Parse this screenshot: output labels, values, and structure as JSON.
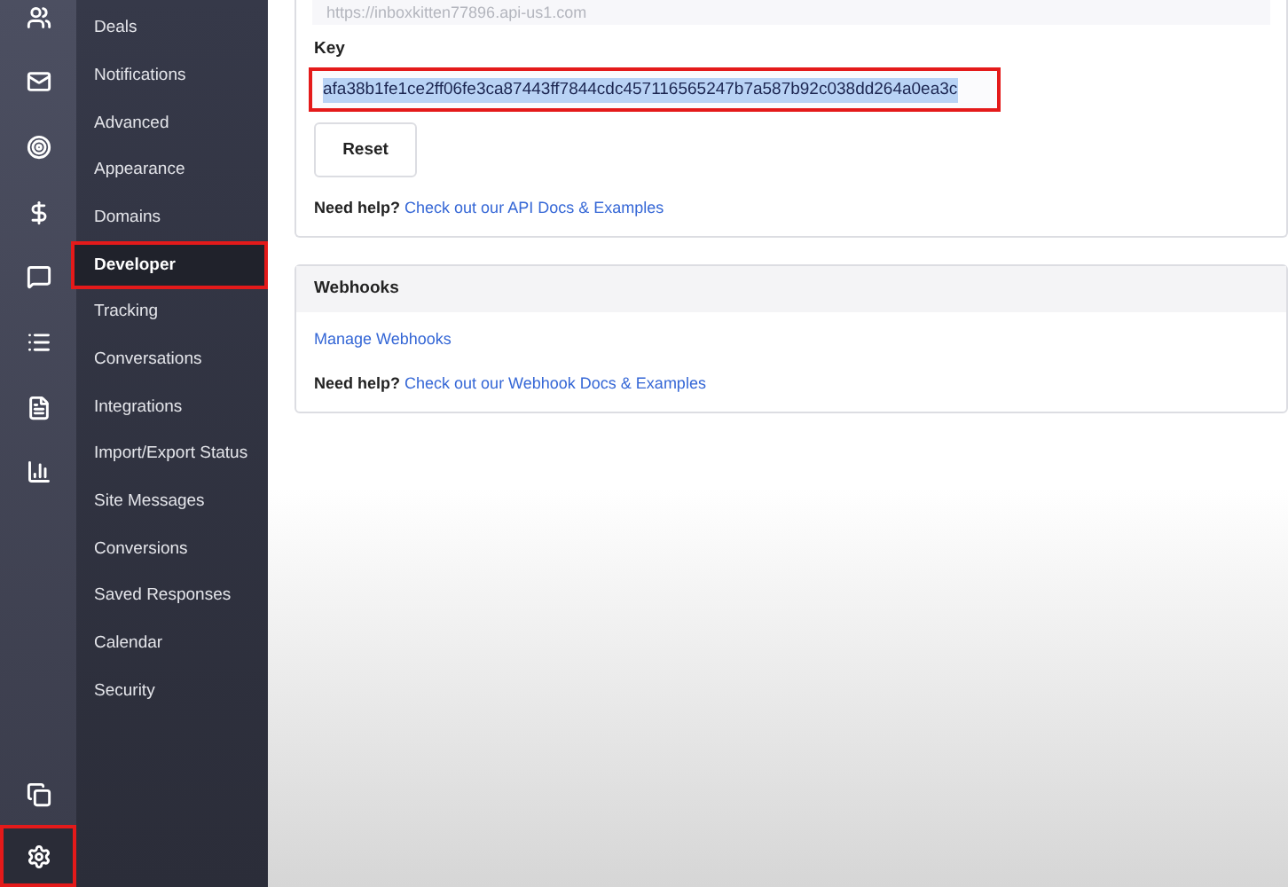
{
  "icon_rail": {
    "items": [
      {
        "kind": "contacts"
      },
      {
        "kind": "mail"
      },
      {
        "kind": "target"
      },
      {
        "kind": "dollar"
      },
      {
        "kind": "chat"
      },
      {
        "kind": "list"
      },
      {
        "kind": "form"
      },
      {
        "kind": "chart"
      }
    ],
    "bottom": [
      {
        "kind": "windows",
        "highlighted": false
      },
      {
        "kind": "settings",
        "highlighted": true
      }
    ]
  },
  "sidebar": {
    "items": [
      {
        "label": "Deals",
        "selected": false,
        "highlighted": false
      },
      {
        "label": "Notifications",
        "selected": false,
        "highlighted": false
      },
      {
        "label": "Advanced",
        "selected": false,
        "highlighted": false
      },
      {
        "label": "Appearance",
        "selected": false,
        "highlighted": false
      },
      {
        "label": "Domains",
        "selected": false,
        "highlighted": false
      },
      {
        "label": "Developer",
        "selected": true,
        "highlighted": true
      },
      {
        "label": "Tracking",
        "selected": false,
        "highlighted": false
      },
      {
        "label": "Conversations",
        "selected": false,
        "highlighted": false
      },
      {
        "label": "Integrations",
        "selected": false,
        "highlighted": false
      },
      {
        "label": "Import/Export Status",
        "selected": false,
        "highlighted": false
      },
      {
        "label": "Site Messages",
        "selected": false,
        "highlighted": false
      },
      {
        "label": "Conversions",
        "selected": false,
        "highlighted": false
      },
      {
        "label": "Saved Responses",
        "selected": false,
        "highlighted": false
      },
      {
        "label": "Calendar",
        "selected": false,
        "highlighted": false
      },
      {
        "label": "Security",
        "selected": false,
        "highlighted": false
      }
    ]
  },
  "api_card": {
    "url_value": "https://inboxkitten77896.api-us1.com",
    "key_label": "Key",
    "key_value": "afa38b1fe1ce2ff06fe3ca87443ff7844cdc457116565247b7a587b92c038dd264a0ea3c",
    "key_highlighted": true,
    "key_selected": true,
    "reset_button": "Reset",
    "help_label": "Need help?",
    "help_link": "Check out our API Docs & Examples"
  },
  "webhooks_card": {
    "title": "Webhooks",
    "manage_link": "Manage Webhooks",
    "help_label": "Need help?",
    "help_link": "Check out our Webhook Docs & Examples"
  }
}
